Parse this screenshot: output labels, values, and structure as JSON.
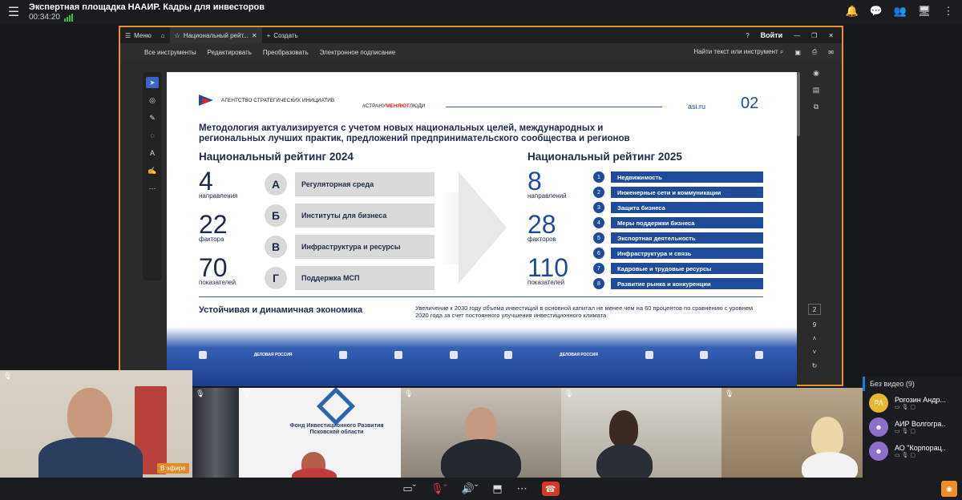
{
  "conference": {
    "title": "Экспертная площадка НААИР. Кадры для инвесторов",
    "timer": "00:34:20"
  },
  "acrobat": {
    "tabs": {
      "menu": "Меню",
      "doc": "Национальный рейт...",
      "create": "Создать"
    },
    "login": "Войти",
    "menu_items": [
      "Все инструменты",
      "Редактировать",
      "Преобразовать",
      "Электронное подписание"
    ],
    "find": "Найти текст или инструмент",
    "page_current": "2",
    "page_total": "9"
  },
  "slide": {
    "agency": "АГЕНТСТВО СТРАТЕГИЧЕСКИХ ИНИЦИАТИВ",
    "slogan_pre": "#",
    "slogan_a": "СТРАНУ",
    "slogan_b": "МЕНЯЮТ",
    "slogan_c": "ЛЮДИ",
    "site": "asi.ru",
    "page": "02",
    "headline": "Методология актуализируется с учетом новых национальных целей, международных и региональных лучших практик, предложений предпринимательского сообщества и регионов",
    "rating2024": "Национальный рейтинг 2024",
    "rating2025": "Национальный рейтинг 2025",
    "stats2024": [
      {
        "num": "4",
        "label": "направления"
      },
      {
        "num": "22",
        "label": "фактора"
      },
      {
        "num": "70",
        "label": "показателей"
      }
    ],
    "stats2025": [
      {
        "num": "8",
        "label": "направлений"
      },
      {
        "num": "28",
        "label": "факторов"
      },
      {
        "num": "110",
        "label": "показателей"
      }
    ],
    "areas2024": [
      {
        "letter": "А",
        "text": "Регуляторная среда"
      },
      {
        "letter": "Б",
        "text": "Институты для бизнеса"
      },
      {
        "letter": "В",
        "text": "Инфраструктура и ресурсы"
      },
      {
        "letter": "Г",
        "text": "Поддержка МСП"
      }
    ],
    "areas2025": [
      {
        "n": "1",
        "text": "Недвижимость"
      },
      {
        "n": "2",
        "text": "Инженерные сети и коммуникации"
      },
      {
        "n": "3",
        "text": "Защита бизнеса"
      },
      {
        "n": "4",
        "text": "Меры поддержки бизнеса"
      },
      {
        "n": "5",
        "text": "Экспортная деятельность"
      },
      {
        "n": "6",
        "text": "Инфраструктура и связь"
      },
      {
        "n": "7",
        "text": "Кадровые и трудовые ресурсы"
      },
      {
        "n": "8",
        "text": "Развитие рынка и конкуренции"
      }
    ],
    "footer_left": "Устойчивая и динамичная экономика",
    "footer_right": "Увеличение к 2030 году объема инвестиций в основной капитал не менее чем на 60 процентов по сравнению с уровнем 2020 года за счет постоянного улучшения инвестиционного климата",
    "partner_logos": [
      "ДЕЛОВАЯ РОССИЯ",
      "ДЕЛОВАЯ РОССИЯ"
    ]
  },
  "video": {
    "on_air": "В эфире",
    "fund_name": "Фонд Инвестиционного Развития Псковской области"
  },
  "participants": {
    "header": "Без видео (9)",
    "items": [
      {
        "initials": "РА",
        "name": "Рогозин Андр...",
        "color": "#e6b82e"
      },
      {
        "initials": "",
        "name": "АИР Волгогра...",
        "color": "#8e6fc8"
      },
      {
        "initials": "",
        "name": "АО \"Корпорац...",
        "color": "#8e6fc8"
      }
    ]
  }
}
